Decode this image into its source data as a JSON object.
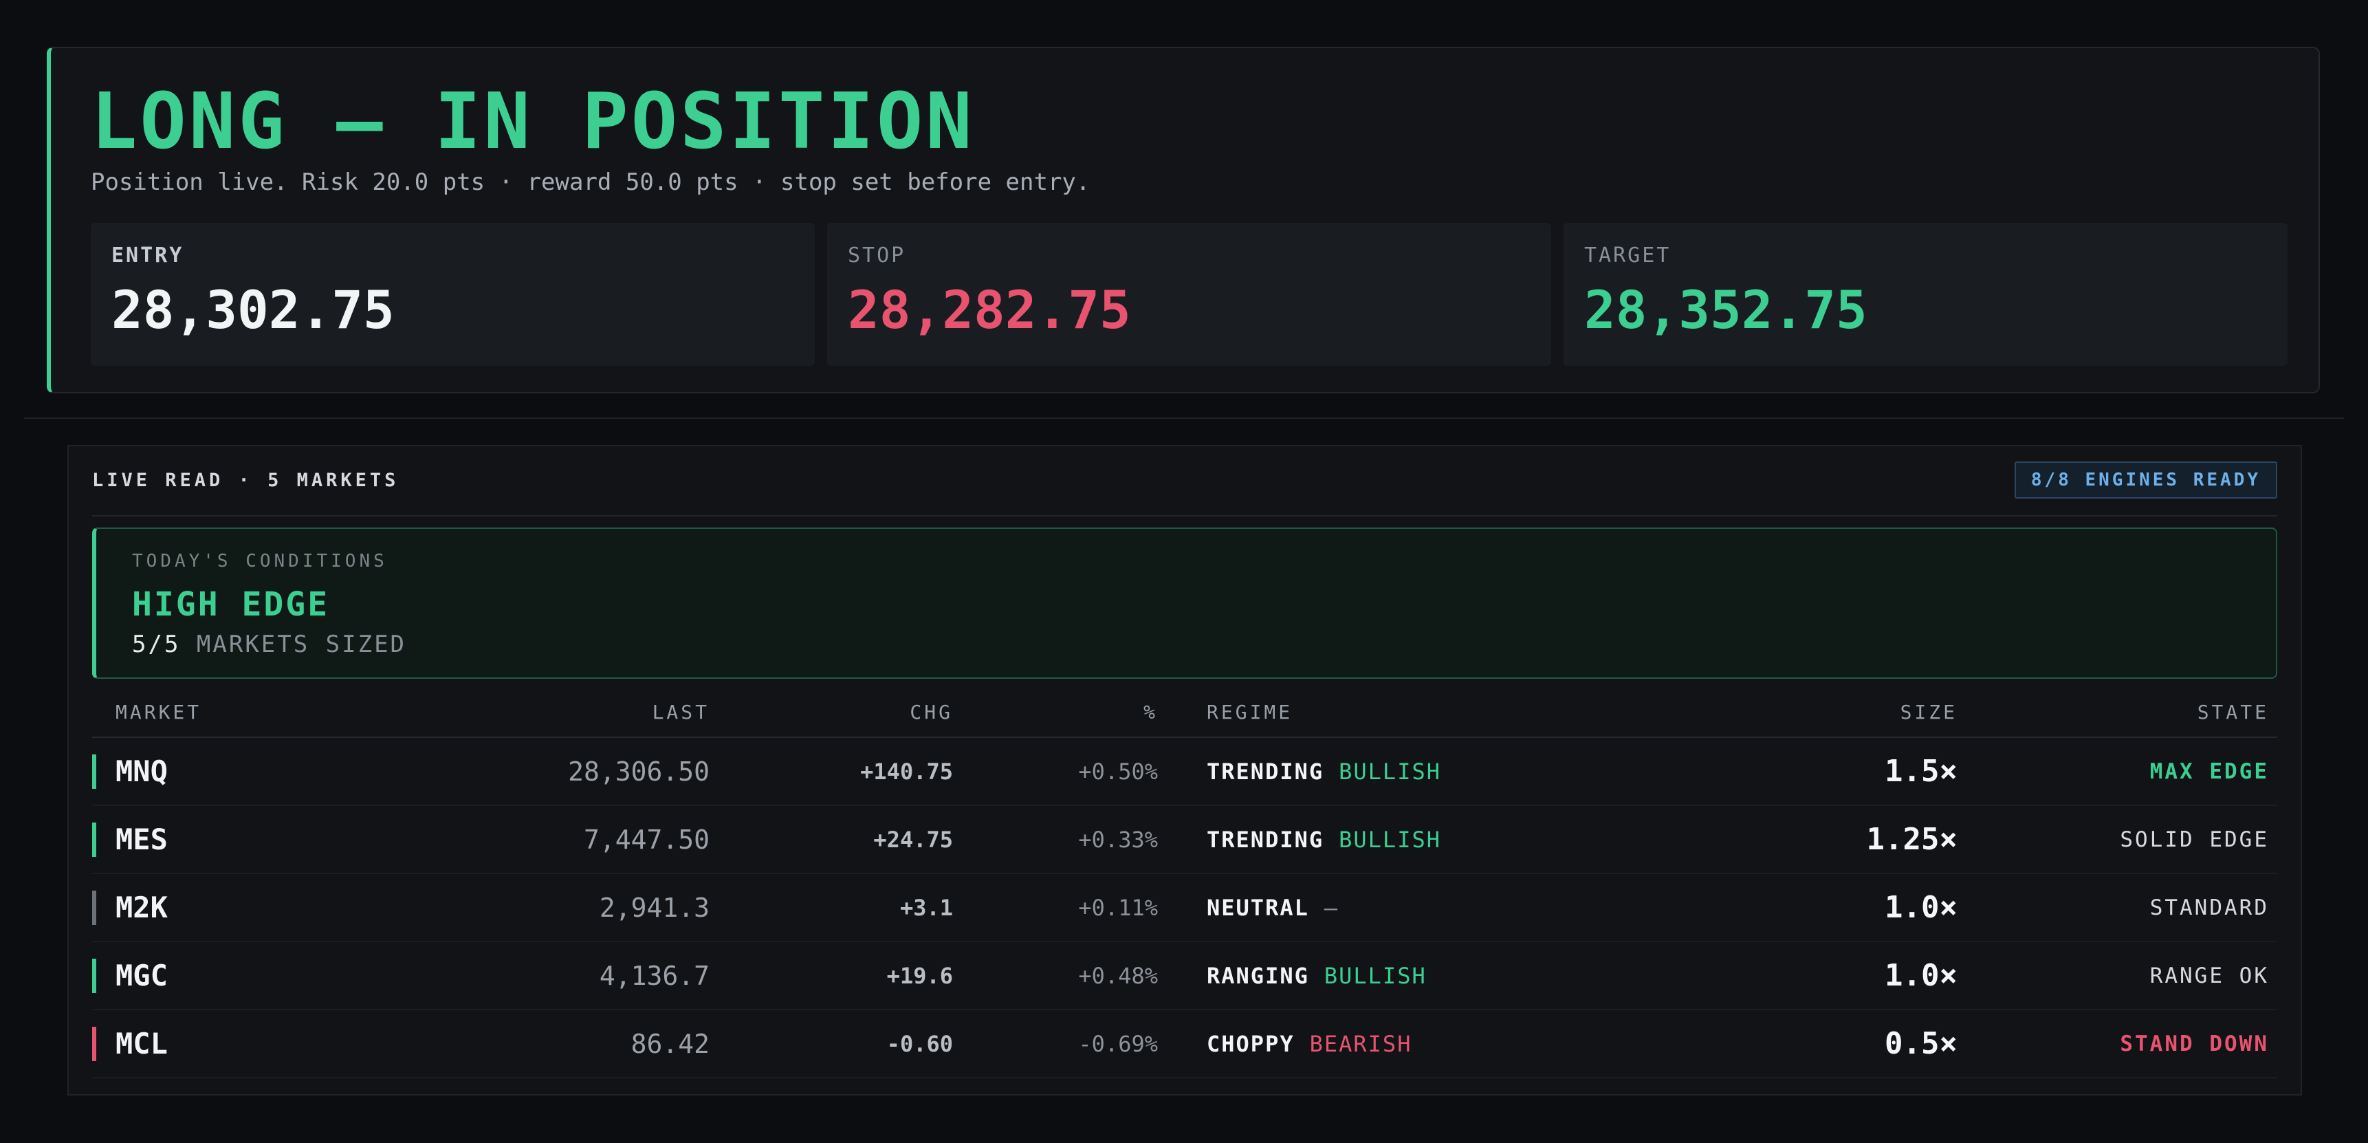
{
  "colors": {
    "green": "#3ccf91",
    "red": "#e8536f",
    "white": "#f2f4f6",
    "neutral": "#6d7178",
    "blue": "#6fb0e8"
  },
  "position": {
    "title": "LONG — IN POSITION",
    "subtitle": "Position live. Risk 20.0 pts · reward 50.0 pts · stop set before entry.",
    "levels": [
      {
        "label": "ENTRY",
        "value": "28,302.75"
      },
      {
        "label": "STOP",
        "value": "28,282.75"
      },
      {
        "label": "TARGET",
        "value": "28,352.75"
      }
    ]
  },
  "live_read": {
    "header": "LIVE READ · 5 MARKETS",
    "engines_badge": "8/8 ENGINES READY",
    "conditions": {
      "label": "TODAY'S CONDITIONS",
      "value": "HIGH EDGE",
      "sized_count": "5/5",
      "sized_text": "MARKETS SIZED"
    },
    "columns": {
      "market": "MARKET",
      "last": "LAST",
      "chg": "CHG",
      "pct": "%",
      "regime": "REGIME",
      "size": "SIZE",
      "state": "STATE"
    },
    "rows": [
      {
        "market": "MNQ",
        "last": "28,306.50",
        "chg": "+140.75",
        "pct": "+0.50%",
        "regime": "TRENDING",
        "bias": "BULLISH",
        "size": "1.5×",
        "state": "MAX EDGE"
      },
      {
        "market": "MES",
        "last": "7,447.50",
        "chg": "+24.75",
        "pct": "+0.33%",
        "regime": "TRENDING",
        "bias": "BULLISH",
        "size": "1.25×",
        "state": "SOLID EDGE"
      },
      {
        "market": "M2K",
        "last": "2,941.3",
        "chg": "+3.1",
        "pct": "+0.11%",
        "regime": "NEUTRAL",
        "bias": "—",
        "size": "1.0×",
        "state": "STANDARD"
      },
      {
        "market": "MGC",
        "last": "4,136.7",
        "chg": "+19.6",
        "pct": "+0.48%",
        "regime": "RANGING",
        "bias": "BULLISH",
        "size": "1.0×",
        "state": "RANGE OK"
      },
      {
        "market": "MCL",
        "last": "86.42",
        "chg": "-0.60",
        "pct": "-0.69%",
        "regime": "CHOPPY",
        "bias": "BEARISH",
        "size": "0.5×",
        "state": "STAND DOWN"
      }
    ]
  }
}
